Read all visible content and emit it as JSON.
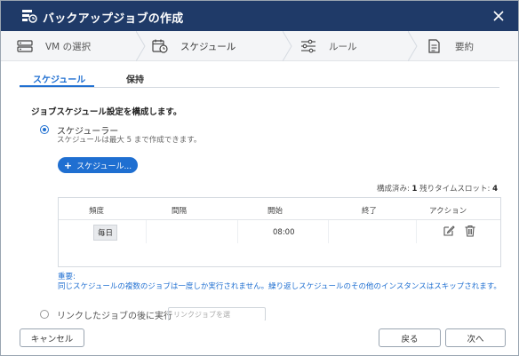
{
  "window": {
    "title": "バックアップジョブの作成"
  },
  "steps": [
    {
      "label": "VM の選択",
      "icon": "server-icon"
    },
    {
      "label": "スケジュール",
      "icon": "calendar-clock-icon"
    },
    {
      "label": "ルール",
      "icon": "sliders-icon"
    },
    {
      "label": "要約",
      "icon": "document-icon"
    }
  ],
  "tabs": [
    {
      "label": "スケジュール",
      "active": true
    },
    {
      "label": "保持",
      "active": false
    }
  ],
  "schedule": {
    "heading": "ジョブスケジュール設定を構成します。",
    "scheduler_label": "スケジューラー",
    "scheduler_sub": "スケジュールは最大 5 まで作成できます。",
    "add_button": "スケジュール...",
    "slots_configured_label": "構成済み:",
    "slots_configured": "1",
    "slots_remaining_label": "残りタイムスロット:",
    "slots_remaining": "4"
  },
  "table": {
    "columns": [
      "頻度",
      "間隔",
      "開始",
      "終了",
      "アクション"
    ],
    "rows": [
      {
        "frequency": "毎日",
        "interval": "",
        "start": "08:00",
        "end": ""
      }
    ]
  },
  "note": {
    "title": "重要:",
    "text": "同じスケジュールの複数のジョブは一度しか実行されません。繰り返しスケジュールのその他のインスタンスはスキップされます。"
  },
  "linked": {
    "label": "リンクしたジョブの後に実行",
    "select_placeholder": "リンクジョブを選"
  },
  "footer": {
    "cancel": "キャンセル",
    "back": "戻る",
    "next": "次へ"
  },
  "colors": {
    "titlebar": "#1f3a68",
    "accent": "#1f6fd1"
  }
}
